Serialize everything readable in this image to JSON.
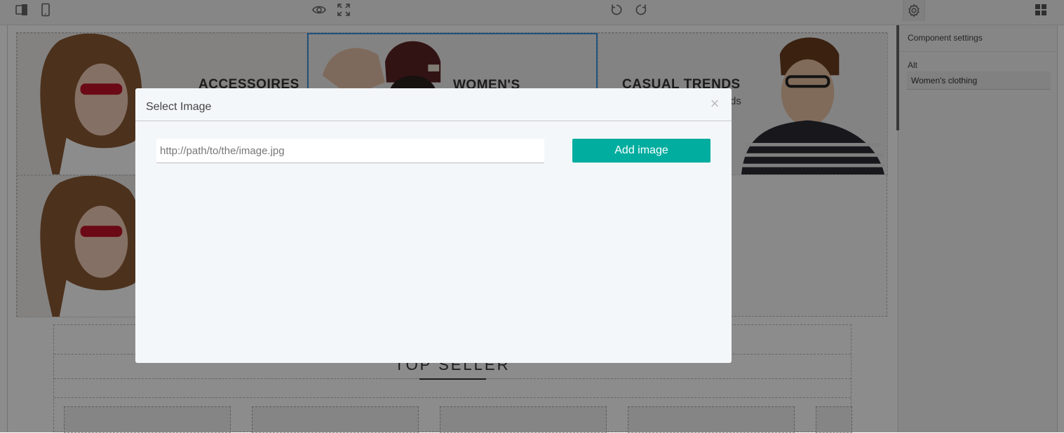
{
  "toolbar": {
    "icons": [
      "devices-icon",
      "mobile-icon",
      "eye-icon",
      "fullscreen-icon",
      "undo-icon",
      "redo-icon",
      "gear-icon",
      "blocks-icon"
    ]
  },
  "canvas": {
    "tiles": [
      {
        "title": "ACCESSOIRES",
        "subtitle": ""
      },
      {
        "title": "WOMEN'S CLOTHING",
        "subtitle": ""
      },
      {
        "title": "CASUAL TRENDS",
        "subtitle": "ds"
      },
      {
        "title": "",
        "subtitle": ""
      }
    ],
    "section_title": "TOP SELLER"
  },
  "side_panel": {
    "title": "Component settings",
    "alt_label": "Alt",
    "alt_value": "Women's clothing"
  },
  "modal": {
    "title": "Select Image",
    "close_symbol": "×",
    "url_placeholder": "http://path/to/the/image.jpg",
    "add_button_label": "Add image"
  },
  "colors": {
    "accent": "#00ad9f",
    "selection": "#3b97e3"
  }
}
